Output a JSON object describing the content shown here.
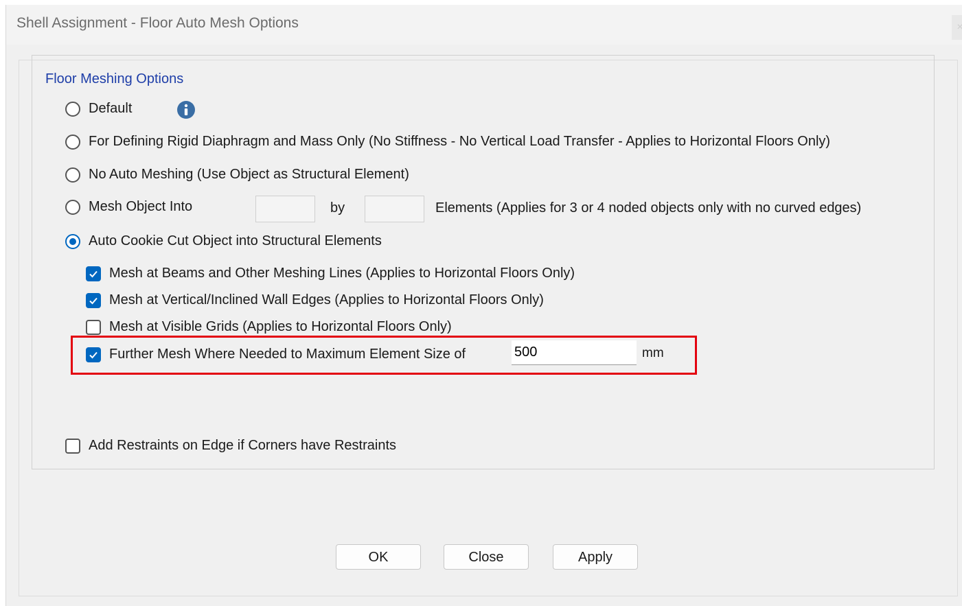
{
  "window": {
    "title": "Shell Assignment - Floor Auto Mesh Options",
    "close_glyph": "×"
  },
  "group": {
    "legend": "Floor Meshing Options"
  },
  "options": {
    "default_label": "Default",
    "rigid_label": "For Defining Rigid Diaphragm and Mass Only  (No Stiffness - No Vertical Load Transfer - Applies to Horizontal Floors Only)",
    "no_mesh_label": "No Auto Meshing  (Use Object as Structural Element)",
    "mesh_into_label": "Mesh Object Into",
    "mesh_into_by": "by",
    "mesh_into_suffix": "Elements (Applies for 3 or 4 noded objects only with no curved edges)",
    "mesh_into_value_1": "",
    "mesh_into_value_2": "",
    "cookie_cut_label": "Auto Cookie Cut Object into Structural Elements",
    "selected": "cookie_cut"
  },
  "sub_options": {
    "beams_label": "Mesh at Beams and Other Meshing Lines  (Applies to Horizontal Floors Only)",
    "beams_checked": true,
    "walls_label": "Mesh at Vertical/Inclined Wall Edges  (Applies to Horizontal Floors Only)",
    "walls_checked": true,
    "grids_label": "Mesh at Visible Grids  (Applies to Horizontal Floors Only)",
    "grids_checked": false,
    "further_label": "Further Mesh Where Needed to Maximum Element Size of",
    "further_checked": true,
    "max_size_value": "500",
    "max_size_unit": "mm"
  },
  "restraints": {
    "label": "Add Restraints on Edge if Corners have Restraints",
    "checked": false
  },
  "buttons": {
    "ok": "OK",
    "close": "Close",
    "apply": "Apply"
  },
  "colors": {
    "accent": "#0067c0",
    "highlight": "#e3000f",
    "legend": "#1e3ea8"
  },
  "icons": {
    "info": "info-icon",
    "check": "checkmark-icon"
  }
}
